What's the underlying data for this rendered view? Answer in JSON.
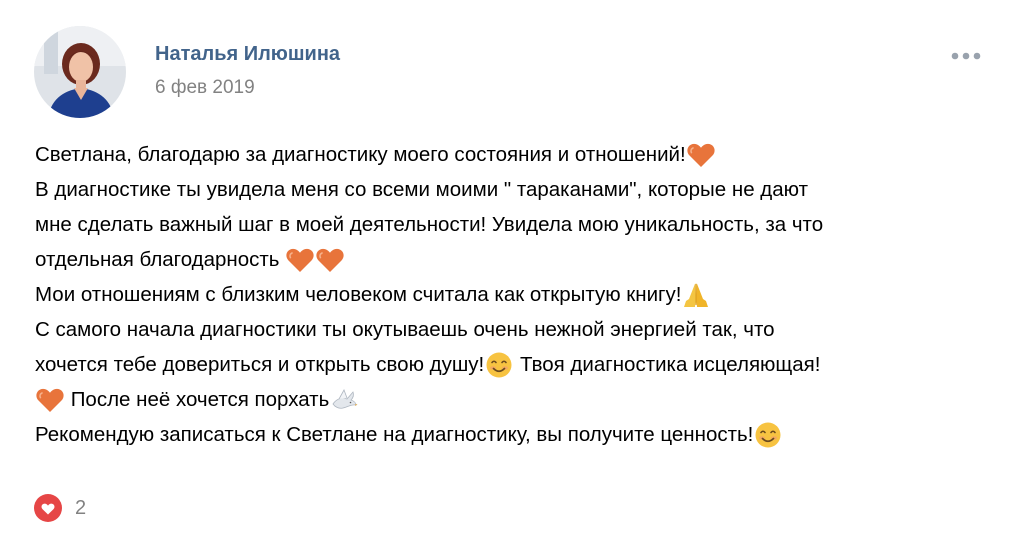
{
  "author": {
    "name": "Наталья Илюшина",
    "date": "6 фев 2019"
  },
  "post": {
    "lines": [
      {
        "segments": [
          {
            "text": "Светлана, благодарю за диагностику моего состояния и отношений!"
          }
        ],
        "emoji_after": [
          "orange-heart"
        ]
      },
      {
        "segments": [
          {
            "text": "В диагностике ты увидела меня со всеми моими \" тараканами\", которые не дают"
          }
        ]
      },
      {
        "segments": [
          {
            "text": "мне сделать важный шаг в моей деятельности! Увидела мою уникальность, за что"
          }
        ]
      },
      {
        "segments": [
          {
            "text": "отдельная благодарность "
          }
        ],
        "emoji_after": [
          "orange-heart",
          "orange-heart"
        ]
      },
      {
        "segments": [
          {
            "text": "Мои отношениям с близким человеком считала как открытую книгу!"
          }
        ],
        "emoji_after": [
          "praying-hands"
        ]
      },
      {
        "segments": [
          {
            "text": "С самого начала диагностики ты окутываешь очень нежной энергией так, что"
          }
        ]
      },
      {
        "segments": [
          {
            "text": "хочется тебе довериться и открыть свою душу!"
          }
        ],
        "emoji_mid": "smiling-face",
        "tail": " Твоя диагностика исцеляющая!"
      },
      {
        "emoji_before": "orange-heart",
        "segments": [
          {
            "text": " После неё хочется порхать"
          }
        ],
        "emoji_after": [
          "dove"
        ]
      },
      {
        "segments": [
          {
            "text": "Рекомендую записаться к Светлане на диагностику, вы получите ценность!"
          }
        ],
        "emoji_after": [
          "smiling-face"
        ]
      }
    ]
  },
  "reactions": {
    "like_icon": "heart-icon",
    "like_count": "2"
  },
  "colors": {
    "author_link": "#42648b",
    "meta_gray": "#828282",
    "like_red": "#e64646",
    "heart_orange": "#e8743b"
  }
}
